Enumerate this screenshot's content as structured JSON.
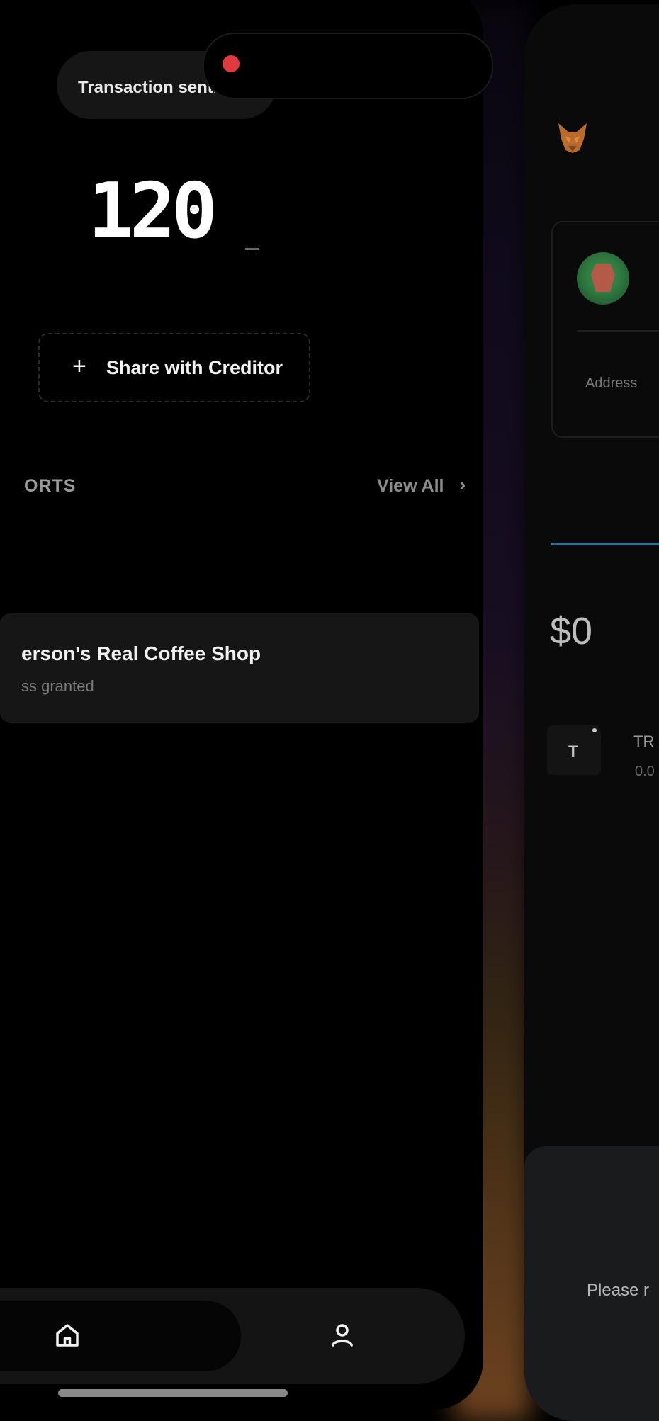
{
  "left_screen": {
    "toast": {
      "text": "Transaction sent."
    },
    "amount": {
      "value": "120"
    },
    "share_button": {
      "icon": "plus-icon",
      "label": "Share with Creditor"
    },
    "reports_section": {
      "title": "ORTS",
      "view_all_label": "View All",
      "view_all_icon": "chevron-right-icon"
    },
    "reports": [
      {
        "title": "erson's Real Coffee Shop",
        "subtitle": "ss granted"
      }
    ],
    "tabbar": {
      "items": [
        {
          "icon": "home-icon",
          "active": true
        },
        {
          "icon": "user-icon",
          "active": false
        }
      ]
    }
  },
  "right_screen": {
    "brand_icon": "fox-icon",
    "account": {
      "avatar": "avatar",
      "address_label": "Address"
    },
    "balance": "$0",
    "tokens": [
      {
        "symbol": "T",
        "name": "TR",
        "amount": "0.0"
      }
    ],
    "bottom_sheet": {
      "text": "Please r"
    }
  },
  "colors": {
    "background": "#000000",
    "recording_dot": "#e0393e",
    "progress_accent": "#2d6f8c",
    "card_surface": "#161617"
  }
}
